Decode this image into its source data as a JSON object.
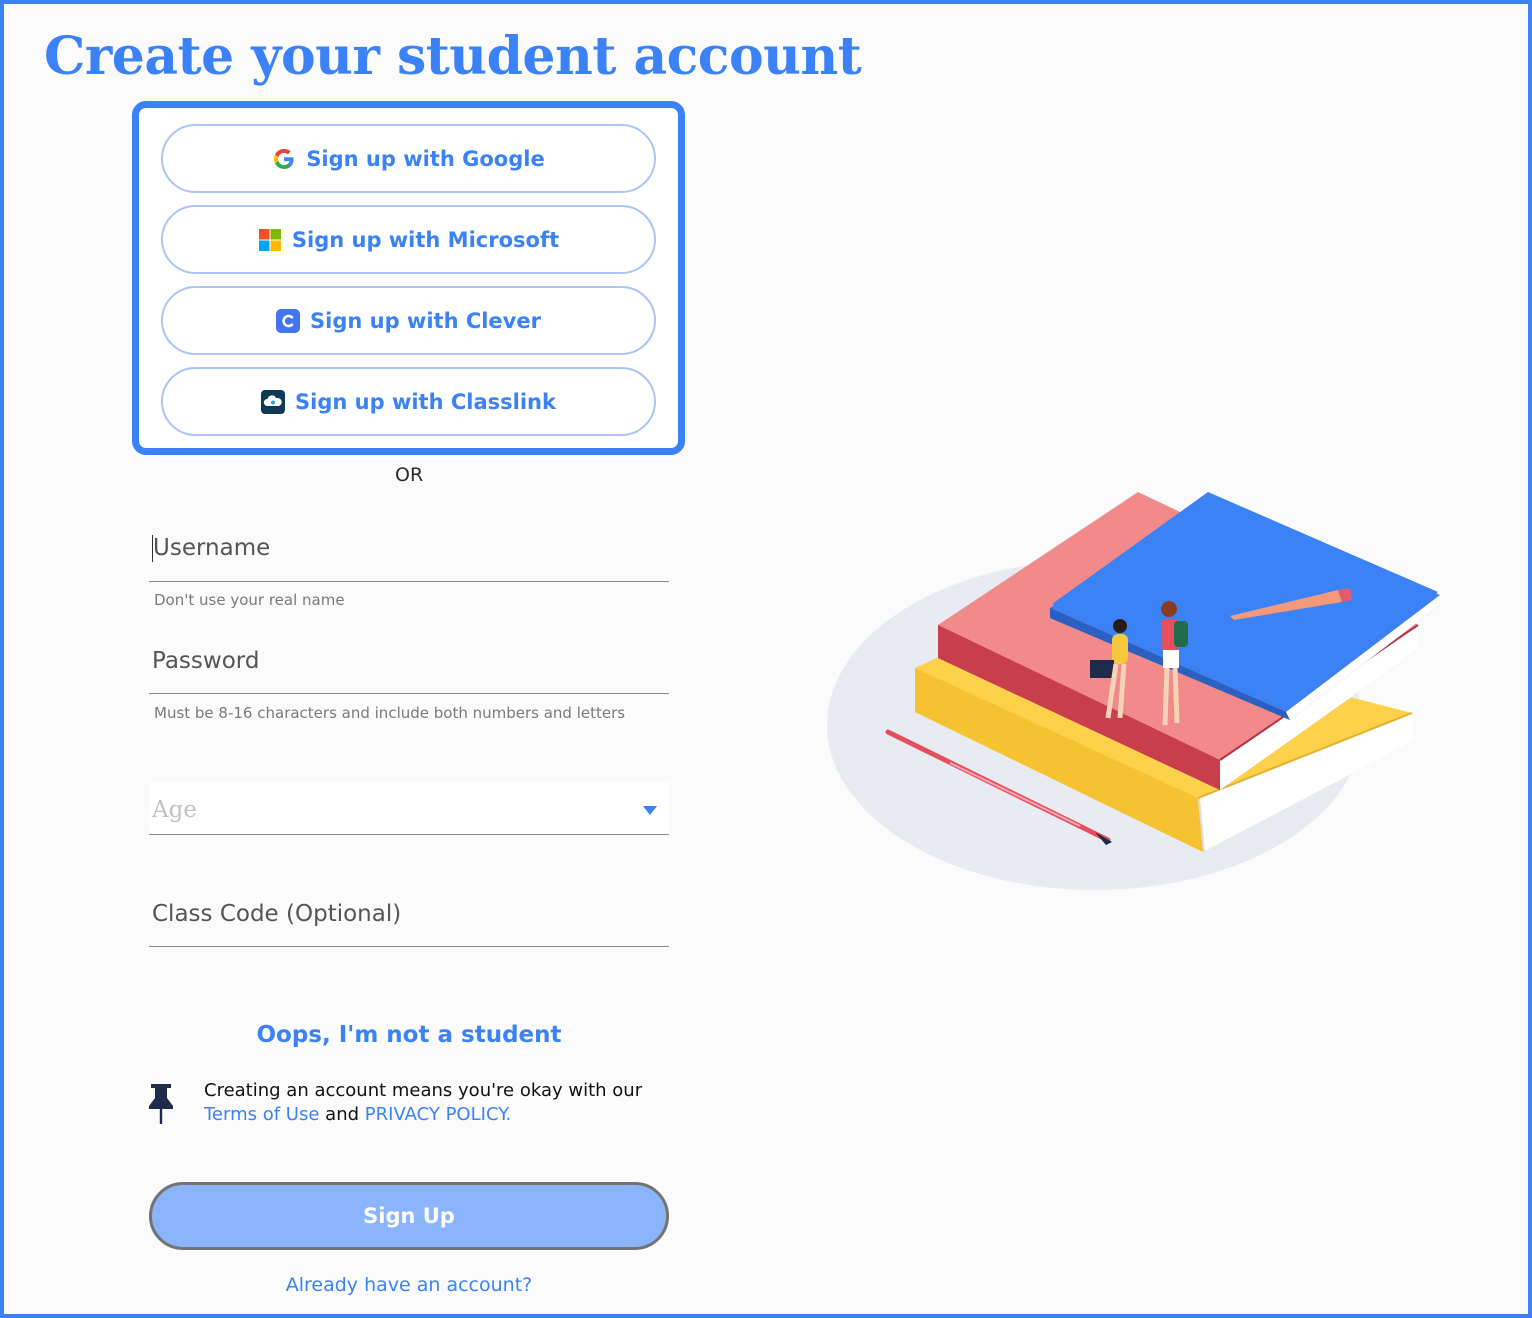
{
  "page": {
    "title": "Create your student account"
  },
  "sso": {
    "google": "Sign up with Google",
    "microsoft": "Sign up with Microsoft",
    "clever": "Sign up with Clever",
    "classlink": "Sign up with Classlink"
  },
  "divider": "OR",
  "form": {
    "username": {
      "placeholder": "Username",
      "hint": "Don't use your real name"
    },
    "password": {
      "placeholder": "Password",
      "hint": "Must be 8-16 characters and include both numbers and letters"
    },
    "age": {
      "placeholder": "Age"
    },
    "class_code": {
      "placeholder": "Class Code (Optional)"
    }
  },
  "not_student_link": "Oops, I'm not a student",
  "terms": {
    "prefix": "Creating an account means you're okay with our",
    "terms_link": "Terms of Use",
    "and": "and",
    "privacy_link": "PRIVACY POLICY."
  },
  "signup_button": "Sign Up",
  "login_link": "Already have an account?",
  "colors": {
    "accent": "#3b82f6",
    "signup_button_bg": "#8ab4fb",
    "sso_border": "#a9c4f5"
  },
  "icons": [
    "google-icon",
    "microsoft-icon",
    "clever-icon",
    "classlink-icon",
    "pushpin-icon",
    "chevron-down-icon"
  ]
}
